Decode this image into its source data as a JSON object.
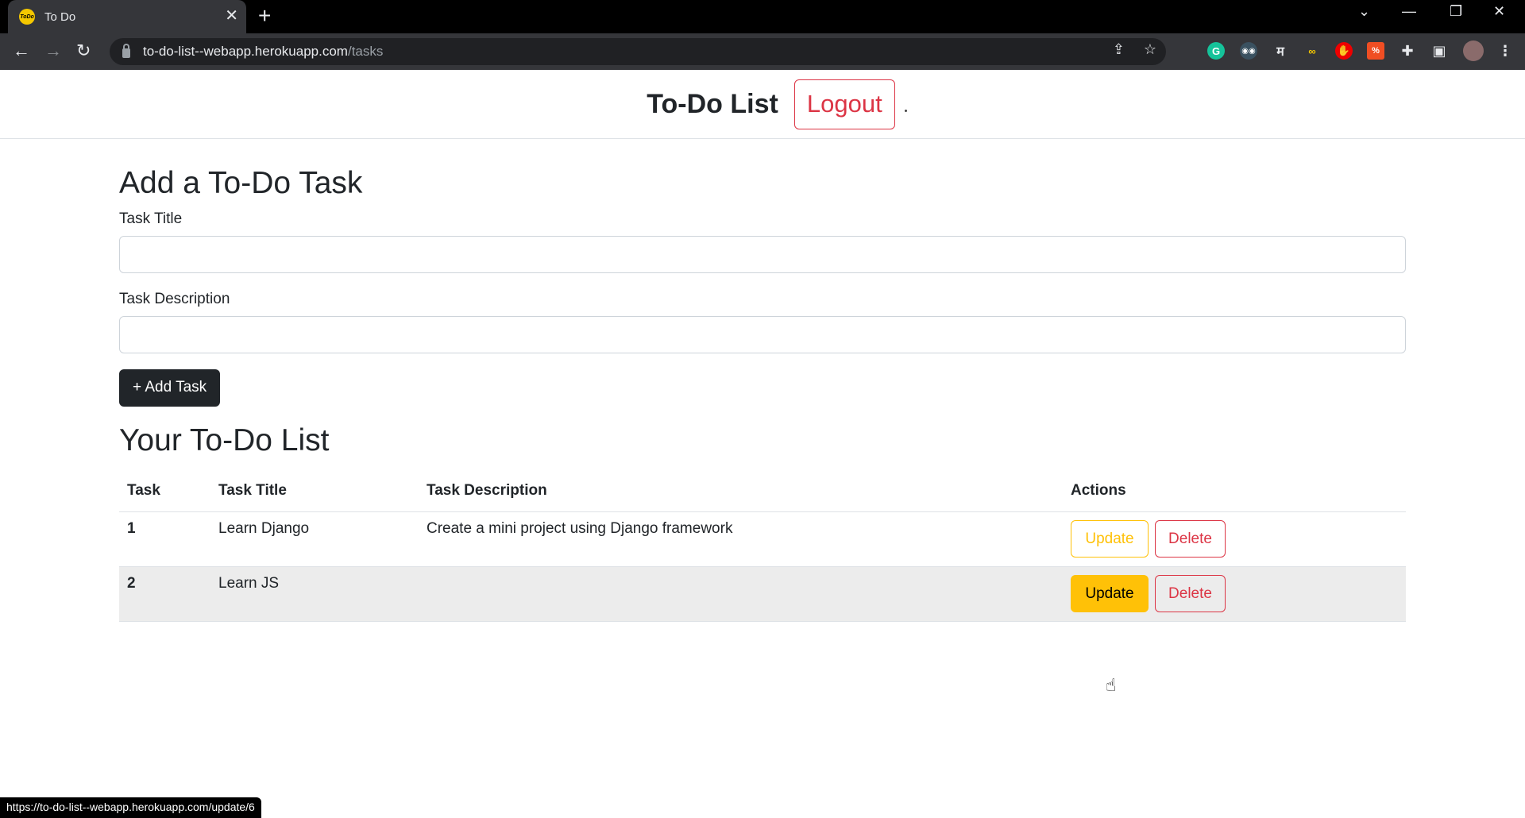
{
  "browser": {
    "tab_title": "To Do",
    "favicon_text": "ToDo",
    "url_host": "to-do-list--webapp.herokuapp.com",
    "url_path": "/tasks",
    "status_url": "https://to-do-list--webapp.herokuapp.com/update/6"
  },
  "navbar": {
    "brand": "To-Do List",
    "logout_label": "Logout"
  },
  "form": {
    "heading": "Add a To-Do Task",
    "title_label": "Task Title",
    "title_value": "",
    "description_label": "Task Description",
    "description_value": "",
    "add_button_label": "+ Add Task"
  },
  "list": {
    "heading": "Your To-Do List",
    "columns": [
      "Task",
      "Task Title",
      "Task Description",
      "Actions"
    ],
    "rows": [
      {
        "num": "1",
        "title": "Learn Django",
        "description": "Create a mini project using Django framework",
        "update_label": "Update",
        "delete_label": "Delete"
      },
      {
        "num": "2",
        "title": "Learn JS",
        "description": "",
        "update_label": "Update",
        "delete_label": "Delete"
      }
    ]
  },
  "colors": {
    "warning": "#ffc107",
    "danger": "#dc3545",
    "dark": "#212529"
  }
}
